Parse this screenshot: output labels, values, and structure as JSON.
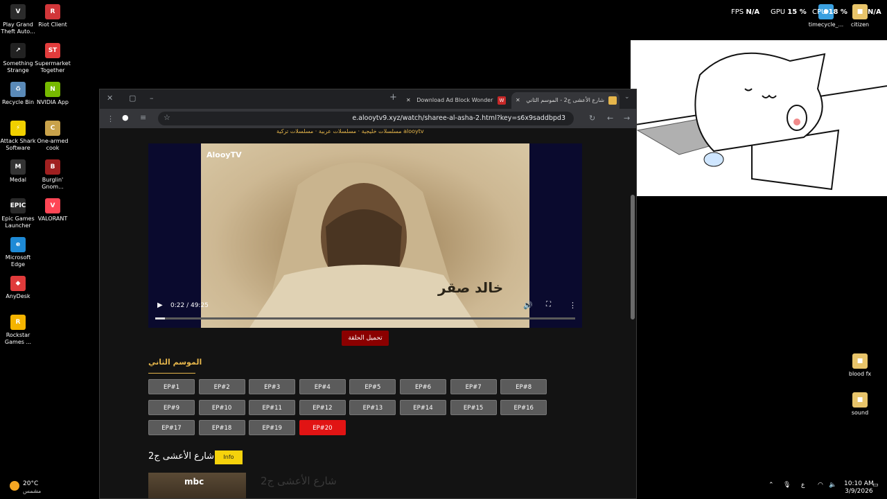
{
  "desktop_icons": [
    {
      "label": "Play Grand Theft Auto...",
      "glyph": "V",
      "color": "#2b2b2b"
    },
    {
      "label": "Riot Client",
      "glyph": "R",
      "color": "#d13639"
    },
    {
      "label": "Something Strange",
      "glyph": "↗",
      "color": "#222222"
    },
    {
      "label": "Supermarket Together",
      "glyph": "ST",
      "color": "#e23c3c"
    },
    {
      "label": "Recycle Bin",
      "glyph": "♻",
      "color": "#5a8ab8"
    },
    {
      "label": "NVIDIA App",
      "glyph": "N",
      "color": "#76b900"
    },
    {
      "label": "Attack Shark Software",
      "glyph": "⚡",
      "color": "#f0d000"
    },
    {
      "label": "One-armed cook",
      "glyph": "C",
      "color": "#c9a24a"
    },
    {
      "label": "Medal",
      "glyph": "M",
      "color": "#333333"
    },
    {
      "label": "Burglin' Gnom...",
      "glyph": "B",
      "color": "#a02020"
    },
    {
      "label": "Epic Games Launcher",
      "glyph": "EPIC",
      "color": "#2a2a2a"
    },
    {
      "label": "VALORANT",
      "glyph": "V",
      "color": "#ff4655"
    },
    {
      "label": "Microsoft Edge",
      "glyph": "e",
      "color": "#1e8ad6"
    },
    {
      "label": "AnyDesk",
      "glyph": "◆",
      "color": "#e03b3b"
    },
    {
      "label": "Rockstar Games ...",
      "glyph": "R",
      "color": "#f5b400"
    },
    {
      "label": "timecycle_...",
      "glyph": "●",
      "color": "#3aa0e0"
    },
    {
      "label": "citizen",
      "glyph": "■",
      "color": "#e8c46a"
    },
    {
      "label": "blood fx",
      "glyph": "■",
      "color": "#e8c46a"
    },
    {
      "label": "sound",
      "glyph": "■",
      "color": "#e8c46a"
    }
  ],
  "perf_overlay": {
    "fps_label": "FPS",
    "fps_value": "N/A",
    "gpu_label": "GPU",
    "gpu_value": "15 %",
    "cpu_label": "CPU",
    "cpu_value": "18 %",
    "ram_value": "N/A"
  },
  "browser": {
    "tabs": [
      {
        "label": "Download Ad Block Wonder",
        "active": false
      },
      {
        "label": "شارع الأعشى ج2 - الموسم الثاني",
        "active": true
      }
    ],
    "url": "e.alooytv9.xyz/watch/sharee-al-asha-2.html?key=s6x9saddbpd3",
    "icons": [
      "minimize-icon",
      "maximize-icon",
      "close-icon",
      "new-tab-icon",
      "back-icon",
      "forward-icon",
      "reload-icon",
      "bookmark-star-icon",
      "menu-icon"
    ]
  },
  "page": {
    "top_nav": "مسلسلات خليجية · مسلسلات عربية · مسلسلات تركية   alooytv",
    "player": {
      "watermark": "AlooyTV",
      "caption": "خالد صقر",
      "time": "0:22 / 49:25",
      "progress_fraction": 0.0074
    },
    "download_label": "تحميل الحلقة",
    "season_title": "الموسم الثاني",
    "episodes": [
      "EP#1",
      "EP#2",
      "EP#3",
      "EP#4",
      "EP#5",
      "EP#6",
      "EP#7",
      "EP#8",
      "EP#9",
      "EP#10",
      "EP#11",
      "EP#12",
      "EP#13",
      "EP#14",
      "EP#15",
      "EP#16",
      "EP#17",
      "EP#18",
      "EP#19",
      "EP#20"
    ],
    "active_episode": "EP#20",
    "show_title": "شارع الأعشى ج2",
    "info_label": "Info",
    "thumb_subtitle": "شارع الأعشى ج2",
    "thumb_logo": "mbc"
  },
  "taskbar": {
    "weather_temp": "20°C",
    "weather_desc": "مشمس",
    "lang": "ع",
    "time": "10:10 AM",
    "date": "3/9/2026"
  }
}
